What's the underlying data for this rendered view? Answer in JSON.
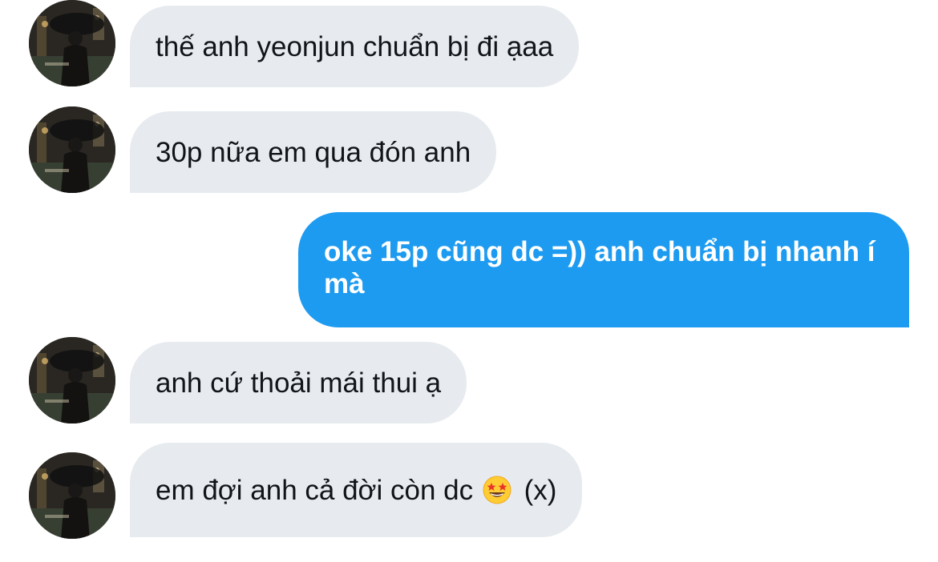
{
  "messages": [
    {
      "sender": "other",
      "text": "thế anh yeonjun chuẩn bị đi ạaa"
    },
    {
      "sender": "other",
      "text": "30p nữa em qua đón anh"
    },
    {
      "sender": "me",
      "text": "oke 15p cũng dc =)) anh chuẩn bị nhanh í mà"
    },
    {
      "sender": "other",
      "text": "anh cứ thoải mái thui ạ"
    },
    {
      "sender": "other",
      "text_before_emoji": "em đợi anh cả đời còn dc",
      "emoji": "star-struck-emoji",
      "text_after_emoji": "(x)"
    }
  ],
  "colors": {
    "incoming_bubble": "#e7ebef",
    "outgoing_bubble": "#1d9bf0",
    "incoming_text": "#111418",
    "outgoing_text": "#ffffff"
  },
  "avatar_icon": "profile-photo-person-with-umbrella"
}
